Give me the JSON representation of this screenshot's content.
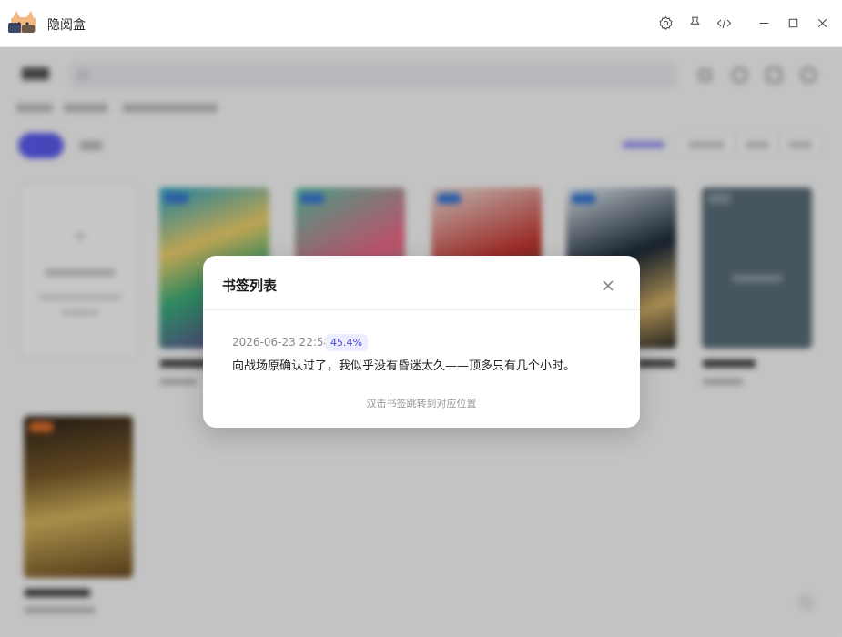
{
  "window": {
    "title": "隐阅盒",
    "icons": [
      "settings-icon",
      "pin-icon",
      "devtools-icon",
      "minimize-icon",
      "maximize-icon",
      "close-icon"
    ]
  },
  "dialog": {
    "title": "书签列表",
    "bookmarks": [
      {
        "time": "2026-06-23 22:58",
        "progress": "45.4%",
        "text": "向战场原确认过了，我似乎没有昏迷太久——顶多只有几个小时。"
      }
    ],
    "hint": "双击书签跳转到对应位置"
  },
  "colors": {
    "accent": "#4b4bd8",
    "accent_bg": "#eceeff",
    "pill_active": "#5b5bf0"
  }
}
